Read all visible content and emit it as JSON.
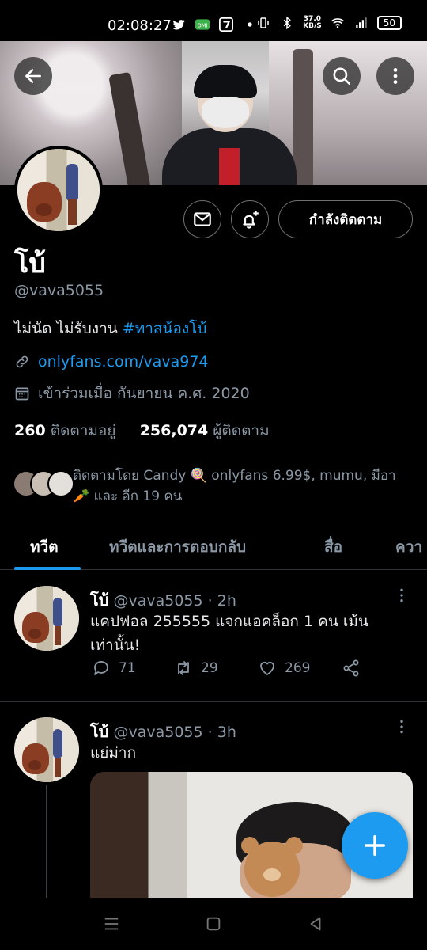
{
  "status_bar": {
    "time": "02:08:27",
    "net_speed_value": "37.0",
    "net_speed_unit": "KB/S",
    "battery": "50",
    "icons": [
      "twitter-icon",
      "omi-icon",
      "seven-eleven-icon",
      "dot-icon",
      "vibrate-icon",
      "bluetooth-icon",
      "wifi-icon",
      "signal-icon",
      "battery-icon"
    ]
  },
  "header": {
    "back_icon": "arrow-left-icon",
    "search_icon": "search-icon",
    "more_icon": "more-vertical-icon"
  },
  "profile": {
    "display_name": "โบ้",
    "handle": "@vava5055",
    "bio_text": "ไม่นัด ไม่รับงาน ",
    "bio_hashtag": "#ทาสน้องโบ้",
    "link": "onlyfans.com/vava974",
    "joined": "เข้าร่วมเมื่อ กันยายน ค.ศ. 2020",
    "following_count": "260",
    "following_label": "ติดตามอยู่",
    "followers_count": "256,074",
    "followers_label": "ผู้ติดตาม",
    "followed_by_line1": "ติดตามโดย Candy 🍭 onlyfans 6.99$, mumu, มีอา",
    "followed_by_line2": "🥕 และ อีก 19 คน"
  },
  "actions": {
    "message_icon": "mail-icon",
    "notify_icon": "bell-plus-icon",
    "follow_label": "กำลังติดตาม"
  },
  "tabs": [
    {
      "label": "ทวีต",
      "active": true
    },
    {
      "label": "ทวีตและการตอบกลับ",
      "active": false
    },
    {
      "label": "สื่อ",
      "active": false
    },
    {
      "label": "ควา",
      "active": false
    }
  ],
  "tweets": [
    {
      "name": "โบ้",
      "handle": "@vava5055",
      "time": "· 2h",
      "text": "แคปฟอล 255555 แจกแอคล็อก 1 คน เม้นเท่านั้น!",
      "replies": "71",
      "retweets": "29",
      "likes": "269"
    },
    {
      "name": "โบ้",
      "handle": "@vava5055",
      "time": "· 3h",
      "text": "แย่ม่าก"
    }
  ],
  "colors": {
    "accent": "#1d9bf0",
    "muted": "#8b98a5",
    "background": "#000000"
  }
}
